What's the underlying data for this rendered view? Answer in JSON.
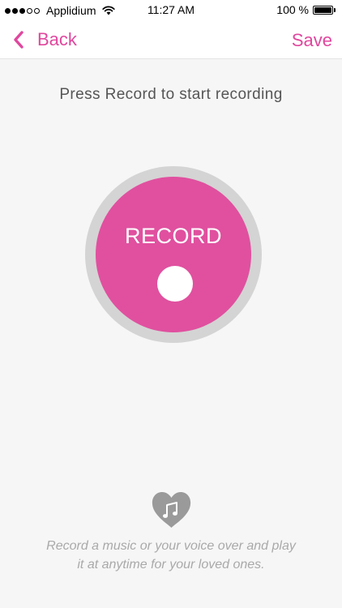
{
  "status_bar": {
    "carrier": "Applidium",
    "time": "11:27 AM",
    "battery": "100 %",
    "signal_bars_filled": 3,
    "signal_bars_total": 5,
    "battery_level_fraction": 1.0
  },
  "nav": {
    "back_label": "Back",
    "save_label": "Save"
  },
  "main": {
    "instruction": "Press Record to start recording",
    "record_label": "RECORD"
  },
  "footer": {
    "line1": "Record a music or your voice over and play",
    "line2": "it at anytime for your loved ones."
  },
  "icons": {
    "back": "chevron-left-icon",
    "wifi": "wifi-icon",
    "battery": "battery-icon",
    "footer": "heart-music-note-icon"
  },
  "colors": {
    "accent": "#e0479e",
    "record_fill": "#e0509f",
    "ring": "#d4d4d4",
    "background": "#f6f6f6",
    "footer_text": "#a9a9a9",
    "heart": "#9a9a9a"
  }
}
